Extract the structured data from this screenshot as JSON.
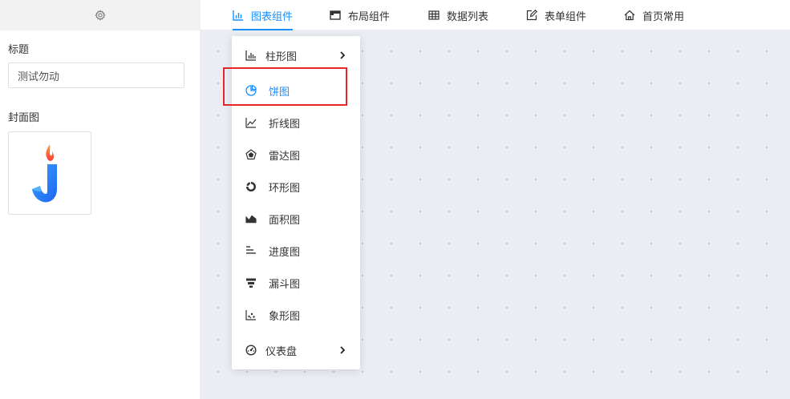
{
  "sidebar": {
    "title_label": "标题",
    "title_value": "测试勿动",
    "cover_label": "封面图"
  },
  "tabs": [
    {
      "label": "图表组件",
      "icon": "bar-chart-icon",
      "active": true
    },
    {
      "label": "布局组件",
      "icon": "layout-icon",
      "active": false
    },
    {
      "label": "数据列表",
      "icon": "table-icon",
      "active": false
    },
    {
      "label": "表单组件",
      "icon": "edit-icon",
      "active": false
    },
    {
      "label": "首页常用",
      "icon": "home-icon",
      "active": false
    }
  ],
  "menu": {
    "items": [
      {
        "label": "柱形图",
        "icon": "bar-chart-icon",
        "has_submenu": true
      },
      {
        "label": "饼图",
        "icon": "pie-chart-icon",
        "active": true
      },
      {
        "label": "折线图",
        "icon": "line-chart-icon"
      },
      {
        "label": "雷达图",
        "icon": "radar-chart-icon"
      },
      {
        "label": "环形图",
        "icon": "ring-chart-icon"
      },
      {
        "label": "面积图",
        "icon": "area-chart-icon"
      },
      {
        "label": "进度图",
        "icon": "progress-chart-icon"
      },
      {
        "label": "漏斗图",
        "icon": "funnel-chart-icon"
      },
      {
        "label": "象形图",
        "icon": "pictorial-chart-icon"
      },
      {
        "label": "仪表盘",
        "icon": "gauge-icon",
        "has_submenu": true
      }
    ]
  },
  "colors": {
    "accent": "#1890ff",
    "highlight_border": "#e5262a",
    "canvas_bg": "#eaedf3"
  }
}
